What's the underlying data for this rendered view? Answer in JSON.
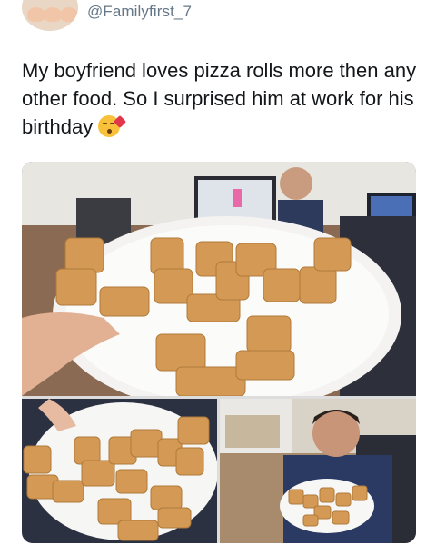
{
  "tweet": {
    "handle": "@Familyfirst_7",
    "text": "My boyfriend loves pizza rolls more then any other food. So I surprised him at work for his birthday",
    "emoji": "face-blowing-a-kiss-icon"
  },
  "media": {
    "photos": [
      {
        "subject": "plate of pizza rolls spelling letters held in office"
      },
      {
        "subject": "close-up of plate of pizza rolls"
      },
      {
        "subject": "man smiling holding plate of pizza rolls"
      }
    ]
  },
  "colors": {
    "text": "#14171a",
    "handle": "#657786",
    "pizza_roll": "#d49a55"
  }
}
